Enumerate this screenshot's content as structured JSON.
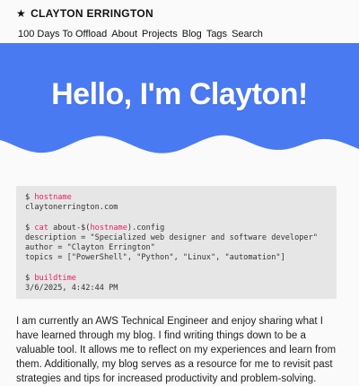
{
  "site": {
    "brand_icon": "star-icon",
    "brand_name": "CLAYTON ERRINGTON"
  },
  "nav": {
    "items": [
      "100 Days To Offload",
      "About",
      "Projects",
      "Blog",
      "Tags",
      "Search"
    ]
  },
  "hero": {
    "heading": "Hello, I'm Clayton!",
    "background_color": "#4a7af1",
    "text_color": "#ffffff"
  },
  "terminal": {
    "prompt": "$",
    "cmd1": "hostname",
    "out1": "claytonerrington.com",
    "cmd2_cat": "cat",
    "cmd2_pre": "about-$(",
    "cmd2_var": "hostname",
    "cmd2_post": ").config",
    "line_description": "description = \"Specialized web designer and software developer\"",
    "line_author": "author = \"Clayton Errington\"",
    "line_topics": "topics = [\"PowerShell\", \"Python\", \"Linux\", \"automation\"]",
    "cmd3": "buildtime",
    "out3": "3/6/2025, 4:42:44 PM",
    "command_color": "#e0245e"
  },
  "bio": {
    "text": "I am currently an AWS Technical Engineer and enjoy sharing what I have learned through my blog. I find writing things down to be a valuable tool. It allows me to reflect on my experiences and learn from them. Additionally, my blog serves as a resource for me to revisit past strategies and tips for increased productivity and problem-solving."
  }
}
